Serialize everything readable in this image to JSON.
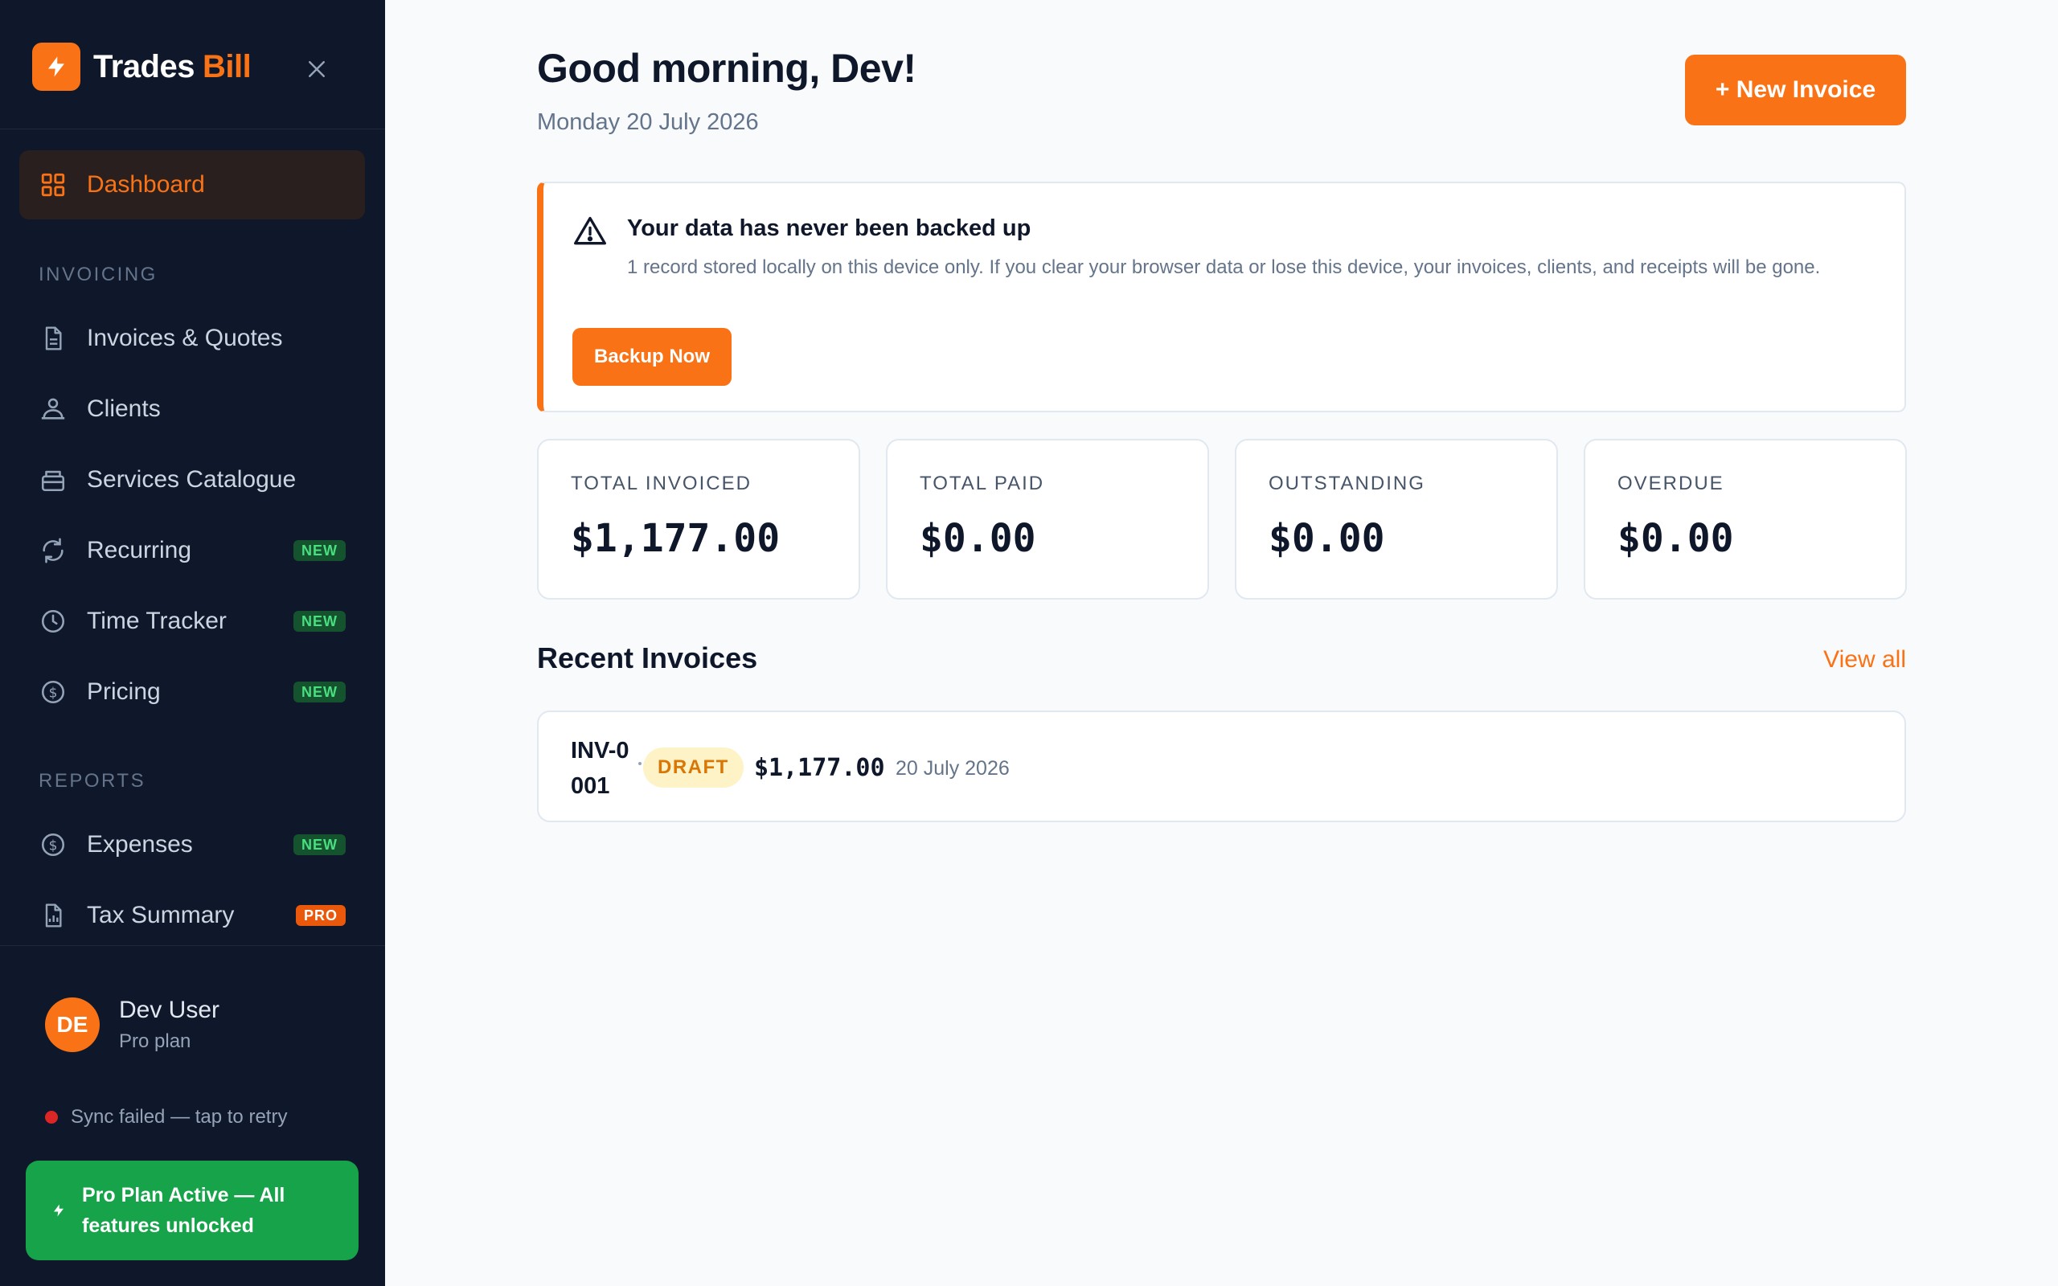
{
  "brand": {
    "name_part1": "Trades",
    "name_part2": "Bill"
  },
  "sidebar": {
    "dashboard_label": "Dashboard",
    "sections": {
      "invoicing": "INVOICING",
      "reports": "REPORTS"
    },
    "items": [
      {
        "label": "Invoices & Quotes",
        "badge": ""
      },
      {
        "label": "Clients",
        "badge": ""
      },
      {
        "label": "Services Catalogue",
        "badge": ""
      },
      {
        "label": "Recurring",
        "badge": "NEW"
      },
      {
        "label": "Time Tracker",
        "badge": "NEW"
      },
      {
        "label": "Pricing",
        "badge": "NEW"
      },
      {
        "label": "Expenses",
        "badge": "NEW"
      },
      {
        "label": "Tax Summary",
        "badge": "PRO"
      }
    ],
    "user": {
      "initials": "DE",
      "name": "Dev User",
      "plan": "Pro plan"
    },
    "sync_status": "Sync failed — tap to retry",
    "pro_card": "Pro Plan Active — All features unlocked"
  },
  "header": {
    "greeting": "Good morning, Dev!",
    "date": "Monday 20 July 2026",
    "new_invoice_label": "+ New Invoice"
  },
  "alert": {
    "title": "Your data has never been backed up",
    "text": "1 record stored locally on this device only. If you clear your browser data or lose this device, your invoices, clients, and receipts will be gone.",
    "button": "Backup Now"
  },
  "stats": [
    {
      "label": "TOTAL INVOICED",
      "value": "$1,177.00"
    },
    {
      "label": "TOTAL PAID",
      "value": "$0.00"
    },
    {
      "label": "OUTSTANDING",
      "value": "$0.00"
    },
    {
      "label": "OVERDUE",
      "value": "$0.00"
    }
  ],
  "recent": {
    "title": "Recent Invoices",
    "view_all": "View all",
    "invoices": [
      {
        "number": "INV-0001",
        "status": "DRAFT",
        "amount": "$1,177.00",
        "date": "20 July 2026"
      }
    ]
  },
  "colors": {
    "accent": "#f97316",
    "sidebar_bg": "#0f172a",
    "success": "#16a34a",
    "error": "#dc2626",
    "draft_bg": "#fef3c7",
    "draft_text": "#d97706"
  },
  "icons": {
    "brand": "bolt-icon",
    "close": "close-icon",
    "dashboard": "grid-icon",
    "invoices": "document-icon",
    "clients": "users-icon",
    "services": "package-icon",
    "recurring": "refresh-icon",
    "time": "clock-icon",
    "pricing": "dollar-circle-icon",
    "expenses": "dollar-circle-icon",
    "tax": "report-icon",
    "alert": "warning-triangle-icon",
    "pro": "bolt-icon"
  }
}
